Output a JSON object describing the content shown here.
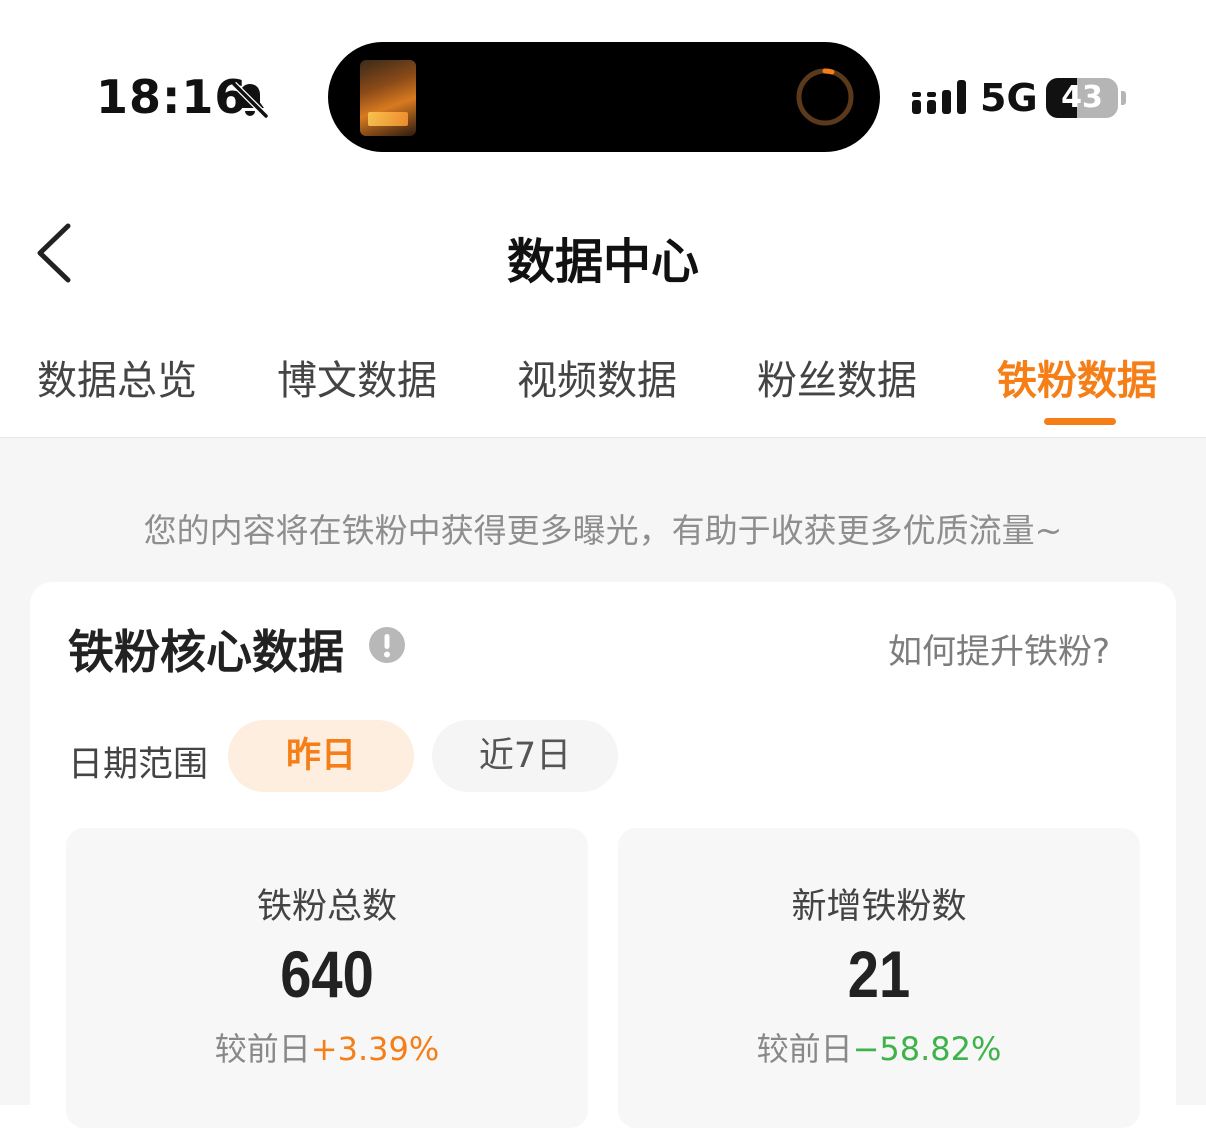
{
  "status_bar": {
    "time": "18:16",
    "network": "5G",
    "battery": "43"
  },
  "header": {
    "title": "数据中心"
  },
  "tabs": [
    {
      "label": "数据总览",
      "active": false
    },
    {
      "label": "博文数据",
      "active": false
    },
    {
      "label": "视频数据",
      "active": false
    },
    {
      "label": "粉丝数据",
      "active": false
    },
    {
      "label": "铁粉数据",
      "active": true
    }
  ],
  "tip": "您的内容将在铁粉中获得更多曝光，有助于收获更多优质流量~",
  "core": {
    "title": "铁粉核心数据",
    "help_link": "如何提升铁粉?",
    "date_range_label": "日期范围",
    "ranges": [
      {
        "label": "昨日",
        "selected": true
      },
      {
        "label": "近7日",
        "selected": false
      }
    ],
    "stats": [
      {
        "label": "铁粉总数",
        "value": "640",
        "compare_prefix": "较前日",
        "change": "+3.39%",
        "trend": "up"
      },
      {
        "label": "新增铁粉数",
        "value": "21",
        "compare_prefix": "较前日",
        "change": "−58.82%",
        "trend": "down"
      }
    ]
  },
  "colors": {
    "accent": "#f57e17",
    "positive": "#f57e17",
    "negative": "#3db34a",
    "page_bg": "#f6f6f6"
  },
  "icons": {
    "bell": "bell-muted-icon",
    "back": "chevron-left-icon",
    "info": "info-circle-icon",
    "signal": "cellular-signal-icon",
    "progress": "progress-ring-icon"
  }
}
